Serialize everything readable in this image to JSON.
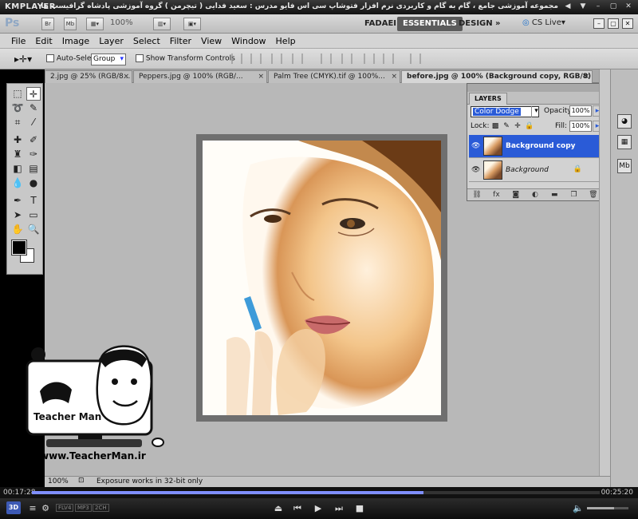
{
  "km_player": {
    "logo": "KMPLAYER",
    "caption": "مجموعه آموزشی جامع ، گام به گام و کاربردی نرم افزار فتوشاپ سی اس فایو  مدرس : سعید فدایی ( تیچرمن ) گروه آموزشی پادشاه گرافیست ها",
    "win_buttons": [
      "◀",
      "▼",
      "–",
      "▢",
      "✕"
    ],
    "time_elapsed": "00:17:28",
    "time_total": "00:25:20",
    "progress": 0.69,
    "volume": 0.65,
    "tags": [
      "FLV4",
      "MP3",
      "2CH"
    ],
    "btn_3d": "3D",
    "controls": [
      "⏏",
      "⏮",
      "▶",
      "⏭",
      "■"
    ],
    "volume_icon": "🔈"
  },
  "appbar": {
    "ps_logo": "Ps",
    "br_label": "Br",
    "mb_label": "Mb",
    "zoom": "100%",
    "workspaces": [
      "FADAEI",
      "ESSENTIALS",
      "DESIGN"
    ],
    "more_label": "»",
    "cs_live": "CS Live"
  },
  "menu": [
    "File",
    "Edit",
    "Image",
    "Layer",
    "Select",
    "Filter",
    "View",
    "Window",
    "Help"
  ],
  "options": {
    "auto_select": "Auto-Select:",
    "group": "Group",
    "show_transform": "Show Transform Controls"
  },
  "tabs": [
    "2.jpg @ 25% (RGB/8...",
    "Peppers.jpg @ 100% (RGB/...",
    "Palm Tree (CMYK).tif @ 100%...",
    "before.jpg @ 100% (Background copy, RGB/8) *"
  ],
  "tab_close": "×",
  "status": {
    "zoom": "100%",
    "text": "Exposure works in 32-bit only"
  },
  "layers": {
    "tab": "LAYERS",
    "blend_mode": "Color Dodge",
    "opacity_label": "Opacity:",
    "opacity": "100%",
    "lock_label": "Lock:",
    "fill_label": "Fill:",
    "fill": "100%",
    "rows": [
      {
        "name": "Background copy",
        "selected": true
      },
      {
        "name": "Background",
        "selected": false
      }
    ]
  },
  "watermark": {
    "name": "Teacher Man",
    "site": "www.TeacherMan.ir"
  },
  "colors": {
    "selection": "#2a5bd7",
    "km_progress": "#7f8fff"
  }
}
